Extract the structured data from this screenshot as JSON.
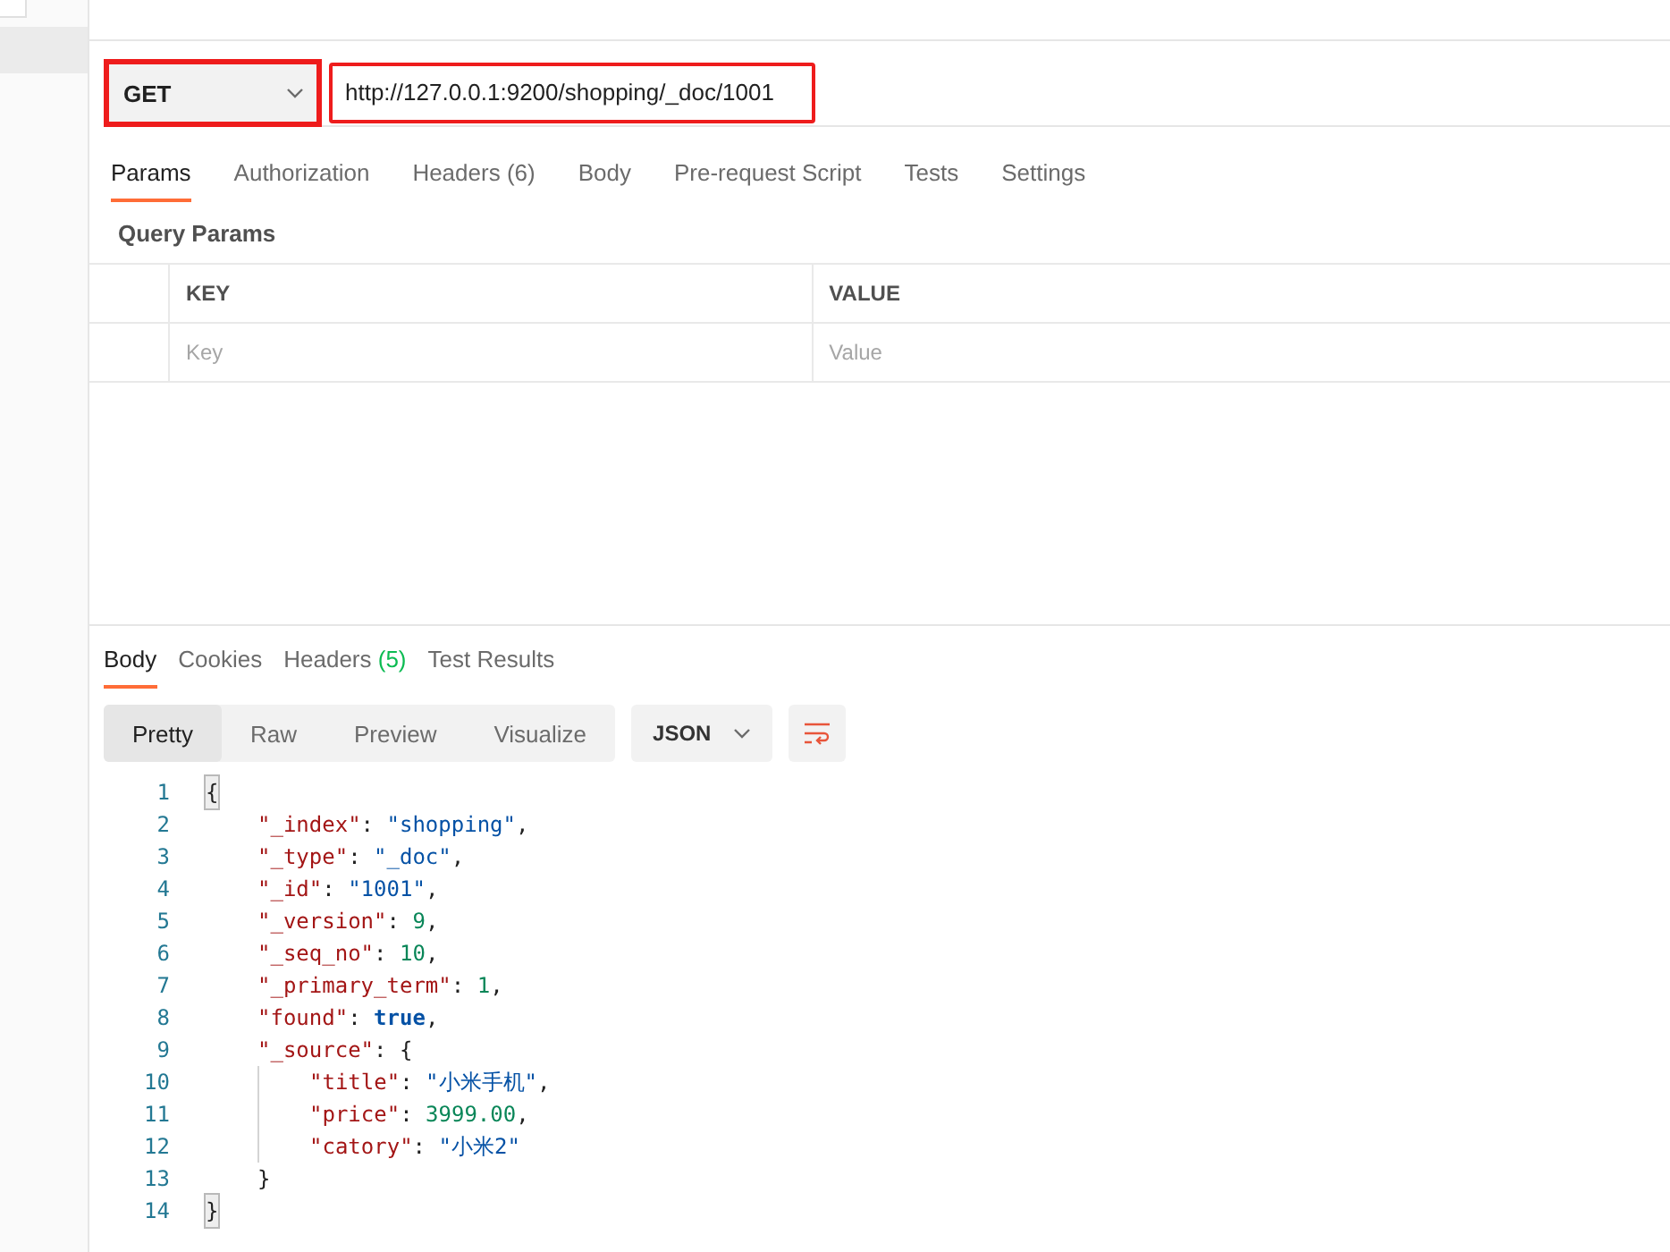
{
  "request": {
    "method": "GET",
    "method_annotated": true,
    "url": "http://127.0.0.1:9200/shopping/_doc/1001",
    "url_annotated": true
  },
  "request_tabs": [
    {
      "label": "Params",
      "selected": true
    },
    {
      "label": "Authorization",
      "selected": false
    },
    {
      "label": "Headers",
      "count": "(6)",
      "selected": false
    },
    {
      "label": "Body",
      "selected": false
    },
    {
      "label": "Pre-request Script",
      "selected": false
    },
    {
      "label": "Tests",
      "selected": false
    },
    {
      "label": "Settings",
      "selected": false
    }
  ],
  "query_params": {
    "title": "Query Params",
    "columns": [
      "KEY",
      "VALUE"
    ],
    "rows": [
      {
        "key_placeholder": "Key",
        "value_placeholder": "Value"
      }
    ]
  },
  "response_tabs": [
    {
      "label": "Body",
      "selected": true
    },
    {
      "label": "Cookies",
      "selected": false
    },
    {
      "label": "Headers",
      "count": "(5)",
      "selected": false
    },
    {
      "label": "Test Results",
      "selected": false
    }
  ],
  "view_modes": [
    {
      "label": "Pretty",
      "selected": true
    },
    {
      "label": "Raw",
      "selected": false
    },
    {
      "label": "Preview",
      "selected": false
    },
    {
      "label": "Visualize",
      "selected": false
    }
  ],
  "format": "JSON",
  "code": [
    {
      "number": "1",
      "tokens": [
        {
          "kind": "punct",
          "text": "{"
        }
      ],
      "children": [
        {
          "number": "2",
          "tokens": [
            {
              "kind": "key",
              "text": "\"_index\""
            },
            {
              "kind": "punct",
              "text": ": "
            },
            {
              "kind": "string",
              "text": "\"shopping\""
            },
            {
              "kind": "punct",
              "text": ","
            }
          ]
        },
        {
          "number": "3",
          "tokens": [
            {
              "kind": "key",
              "text": "\"_type\""
            },
            {
              "kind": "punct",
              "text": ": "
            },
            {
              "kind": "string",
              "text": "\"_doc\""
            },
            {
              "kind": "punct",
              "text": ","
            }
          ]
        },
        {
          "number": "4",
          "tokens": [
            {
              "kind": "key",
              "text": "\"_id\""
            },
            {
              "kind": "punct",
              "text": ": "
            },
            {
              "kind": "string",
              "text": "\"1001\""
            },
            {
              "kind": "punct",
              "text": ","
            }
          ]
        },
        {
          "number": "5",
          "tokens": [
            {
              "kind": "key",
              "text": "\"_version\""
            },
            {
              "kind": "punct",
              "text": ": "
            },
            {
              "kind": "number",
              "text": "9"
            },
            {
              "kind": "punct",
              "text": ","
            }
          ]
        },
        {
          "number": "6",
          "tokens": [
            {
              "kind": "key",
              "text": "\"_seq_no\""
            },
            {
              "kind": "punct",
              "text": ": "
            },
            {
              "kind": "number",
              "text": "10"
            },
            {
              "kind": "punct",
              "text": ","
            }
          ]
        },
        {
          "number": "7",
          "tokens": [
            {
              "kind": "key",
              "text": "\"_primary_term\""
            },
            {
              "kind": "punct",
              "text": ": "
            },
            {
              "kind": "number",
              "text": "1"
            },
            {
              "kind": "punct",
              "text": ","
            }
          ]
        },
        {
          "number": "8",
          "tokens": [
            {
              "kind": "key",
              "text": "\"found\""
            },
            {
              "kind": "punct",
              "text": ": "
            },
            {
              "kind": "boolean",
              "text": "true"
            },
            {
              "kind": "punct",
              "text": ","
            }
          ]
        },
        {
          "number": "9",
          "tokens": [
            {
              "kind": "key",
              "text": "\"_source\""
            },
            {
              "kind": "punct",
              "text": ": {"
            }
          ],
          "children": [
            {
              "number": "10",
              "tokens": [
                {
                  "kind": "key",
                  "text": "\"title\""
                },
                {
                  "kind": "punct",
                  "text": ": "
                },
                {
                  "kind": "string",
                  "text": "\"小米手机\""
                },
                {
                  "kind": "punct",
                  "text": ","
                }
              ]
            },
            {
              "number": "11",
              "tokens": [
                {
                  "kind": "key",
                  "text": "\"price\""
                },
                {
                  "kind": "punct",
                  "text": ": "
                },
                {
                  "kind": "number",
                  "text": "3999.00"
                },
                {
                  "kind": "punct",
                  "text": ","
                }
              ]
            },
            {
              "number": "12",
              "tokens": [
                {
                  "kind": "key",
                  "text": "\"catory\""
                },
                {
                  "kind": "punct",
                  "text": ": "
                },
                {
                  "kind": "string",
                  "text": "\"小米2\""
                }
              ]
            }
          ]
        },
        {
          "number": "13",
          "tokens": [
            {
              "kind": "punct",
              "text": "}"
            }
          ]
        }
      ]
    },
    {
      "number": "14",
      "tokens": [
        {
          "kind": "punct",
          "text": "}"
        }
      ]
    }
  ]
}
